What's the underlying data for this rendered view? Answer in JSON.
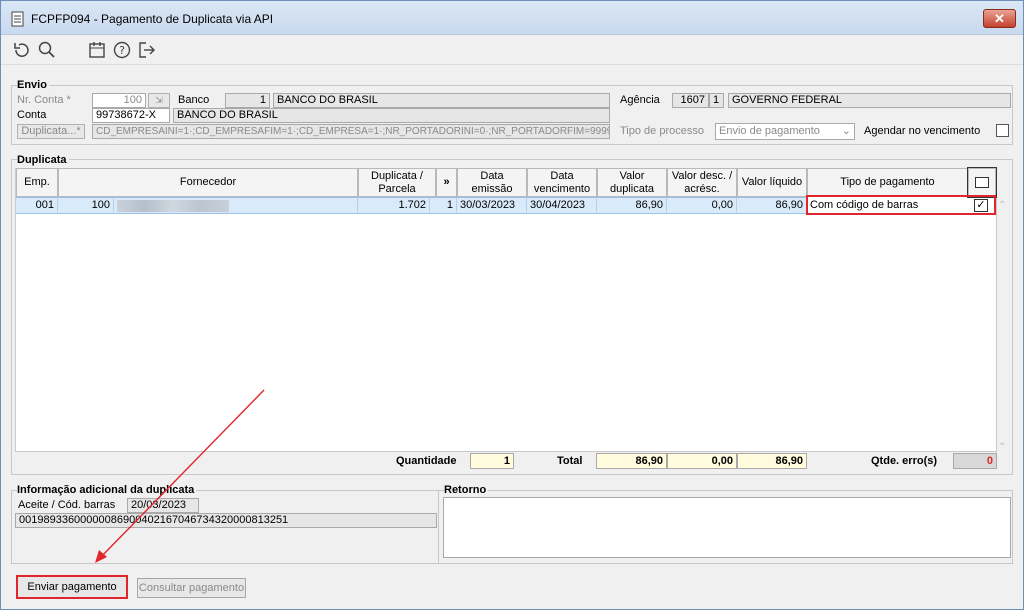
{
  "window": {
    "title": "FCPFP094 - Pagamento de Duplicata via API",
    "close_label": "✕"
  },
  "toolbar": {
    "icons": [
      "undo-icon",
      "search-icon",
      "calendar-icon",
      "help-icon",
      "exit-icon"
    ]
  },
  "envio": {
    "group_title": "Envio",
    "nr_conta_label": "Nr. Conta *",
    "nr_conta_value": "100",
    "banco_label": "Banco",
    "banco_code": "1",
    "banco_name": "BANCO DO BRASIL",
    "agencia_label": "Agência",
    "agencia_code": "1607",
    "agencia_digit": "1",
    "agencia_name": "GOVERNO FEDERAL",
    "conta_label": "Conta",
    "conta_value": "99738672-X",
    "conta_bank": "BANCO DO BRASIL",
    "duplicata_button": "Duplicata...*",
    "duplicata_filter": "CD_EMPRESAINI=1·;CD_EMPRESAFIM=1·;CD_EMPRESA=1·;NR_PORTADORINI=0·;NR_PORTADORFIM=9999",
    "tipo_processo_label": "Tipo de processo",
    "tipo_processo_value": "Envio de pagamento",
    "agendar_label": "Agendar no vencimento"
  },
  "duplicata": {
    "group_title": "Duplicata",
    "columns": {
      "emp": "Emp.",
      "fornecedor": "Fornecedor",
      "duplicata_l1": "Duplicata /",
      "duplicata_l2": "Parcela",
      "more": "»",
      "emissao_l1": "Data",
      "emissao_l2": "emissão",
      "vencimento_l1": "Data",
      "vencimento_l2": "vencimento",
      "valor_l1": "Valor",
      "valor_l2": "duplicata",
      "desc_l1": "Valor desc. /",
      "desc_l2": "acrésc.",
      "liquido": "Valor líquido",
      "tipo_pagamento": "Tipo de pagamento"
    },
    "rows": [
      {
        "emp": "001",
        "fornecedor_code": "100",
        "duplicata": "1.702",
        "parcela": "1",
        "emissao": "30/03/2023",
        "vencimento": "30/04/2023",
        "valor": "86,90",
        "desc": "0,00",
        "liquido": "86,90",
        "tipo_pagamento": "Com código de barras",
        "checked": true
      }
    ],
    "totals": {
      "quantidade_label": "Quantidade",
      "quantidade": "1",
      "total_label": "Total",
      "total_valor": "86,90",
      "total_desc": "0,00",
      "total_liquido": "86,90",
      "erros_label": "Qtde. erro(s)",
      "erros": "0"
    }
  },
  "info": {
    "group_title": "Informação adicional da duplicata",
    "aceite_label": "Aceite / Cód. barras",
    "aceite_date": "20/03/2023",
    "barcode": "00198933600000086900402167046734320000813251"
  },
  "retorno": {
    "group_title": "Retorno"
  },
  "buttons": {
    "enviar": "Enviar pagamento",
    "consultar": "Consultar pagamento"
  },
  "colors": {
    "highlight": "#e0262a",
    "arrow": "#e0262a",
    "selected_row": "#d9ebfb",
    "total_bg": "#fffbdc"
  }
}
